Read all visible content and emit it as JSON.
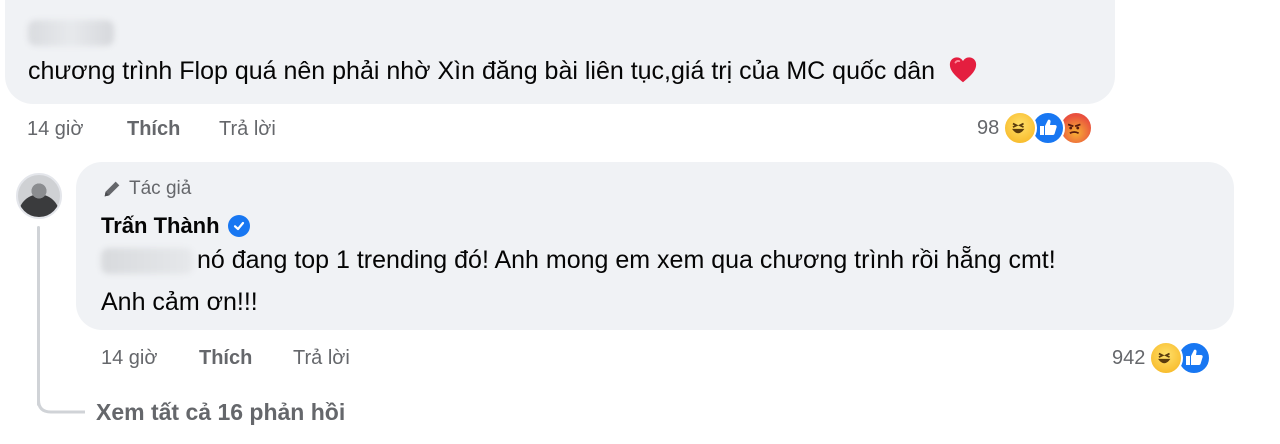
{
  "comment1": {
    "text": "chương trình Flop quá nên phải nhờ Xìn đăng bài liên tục,giá trị của MC quốc dân",
    "time": "14 giờ",
    "like_label": "Thích",
    "reply_label": "Trả lời",
    "reaction_count": "98",
    "reactions": [
      "haha-icon",
      "like-icon",
      "angry-icon"
    ]
  },
  "reply": {
    "author_badge": "Tác giả",
    "author_name": "Trấn Thành",
    "text_line1": "nó đang top 1 trending đó! Anh mong em xem qua chương trình rồi hẵng cmt!",
    "text_line2": "Anh cảm ơn!!!",
    "time": "14 giờ",
    "like_label": "Thích",
    "reply_label": "Trả lời",
    "reaction_count": "942",
    "reactions": [
      "haha-icon",
      "like-icon"
    ]
  },
  "see_all_replies": "Xem tất cả 16 phản hồi",
  "colors": {
    "bubble": "#f0f2f5",
    "muted": "#65676b",
    "accent": "#1877f2",
    "heart": "#e41e3f"
  }
}
